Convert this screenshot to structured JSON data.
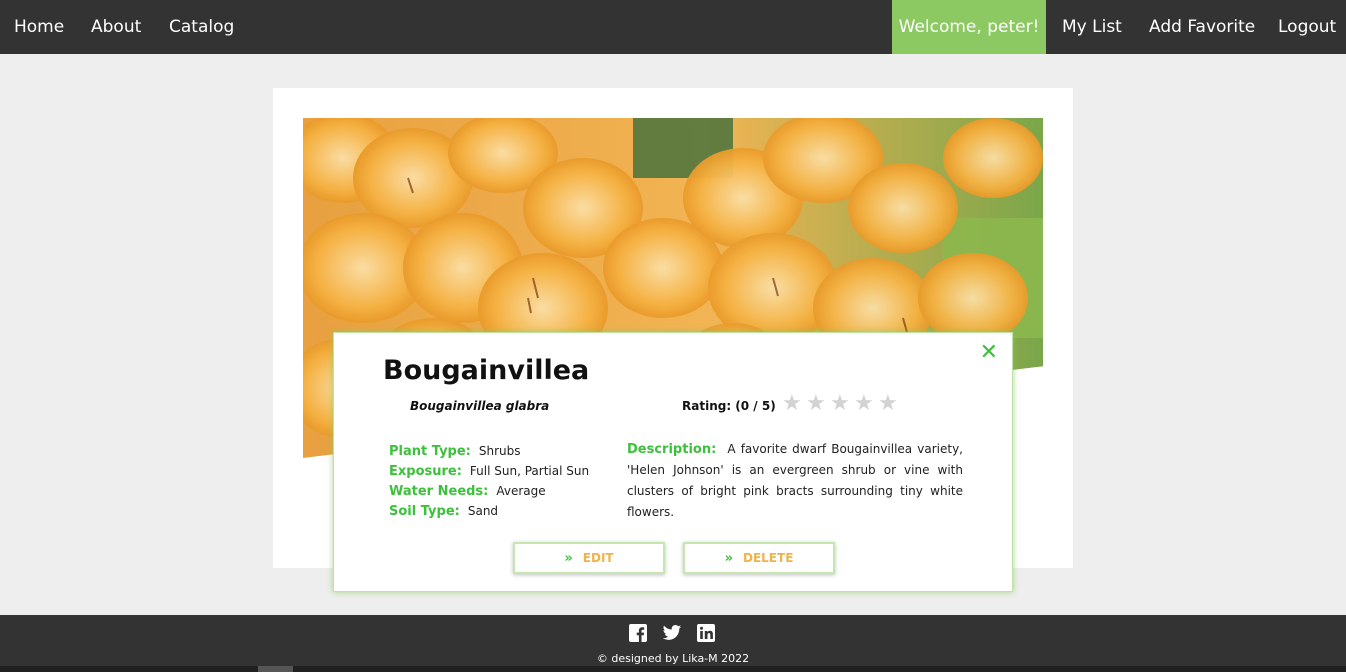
{
  "nav": {
    "home": "Home",
    "about": "About",
    "catalog": "Catalog",
    "welcome": "Welcome, peter!",
    "my_list": "My List",
    "add_favorite": "Add Favorite",
    "logout": "Logout"
  },
  "colors": {
    "nav_bg": "#333333",
    "accent_green": "#8cc963",
    "label_green": "#3cc13b",
    "button_text": "#f0b24a"
  },
  "plant": {
    "name": "Bougainvillea",
    "scientific_name": "Bougainvillea glabra",
    "rating_label": "Rating: (0 / 5)",
    "rating_value": 0,
    "rating_max": 5,
    "properties": [
      {
        "label": "Plant Type:",
        "value": "Shrubs"
      },
      {
        "label": "Exposure:",
        "value": "Full Sun, Partial Sun"
      },
      {
        "label": "Water Needs:",
        "value": "Average"
      },
      {
        "label": "Soil Type:",
        "value": "Sand"
      }
    ],
    "description_label": "Description:",
    "description": "A favorite dwarf Bougainvillea variety, 'Helen Johnson' is an evergreen shrub or vine with clusters of bright pink bracts surrounding tiny white flowers."
  },
  "modal": {
    "close_icon": "close-icon",
    "edit_label": "EDIT",
    "delete_label": "DELETE",
    "button_icon": "double-chevron-right-icon"
  },
  "footer": {
    "icons": [
      "facebook-icon",
      "twitter-icon",
      "linkedin-icon"
    ],
    "copyright": "© designed by Lika-M 2022"
  }
}
